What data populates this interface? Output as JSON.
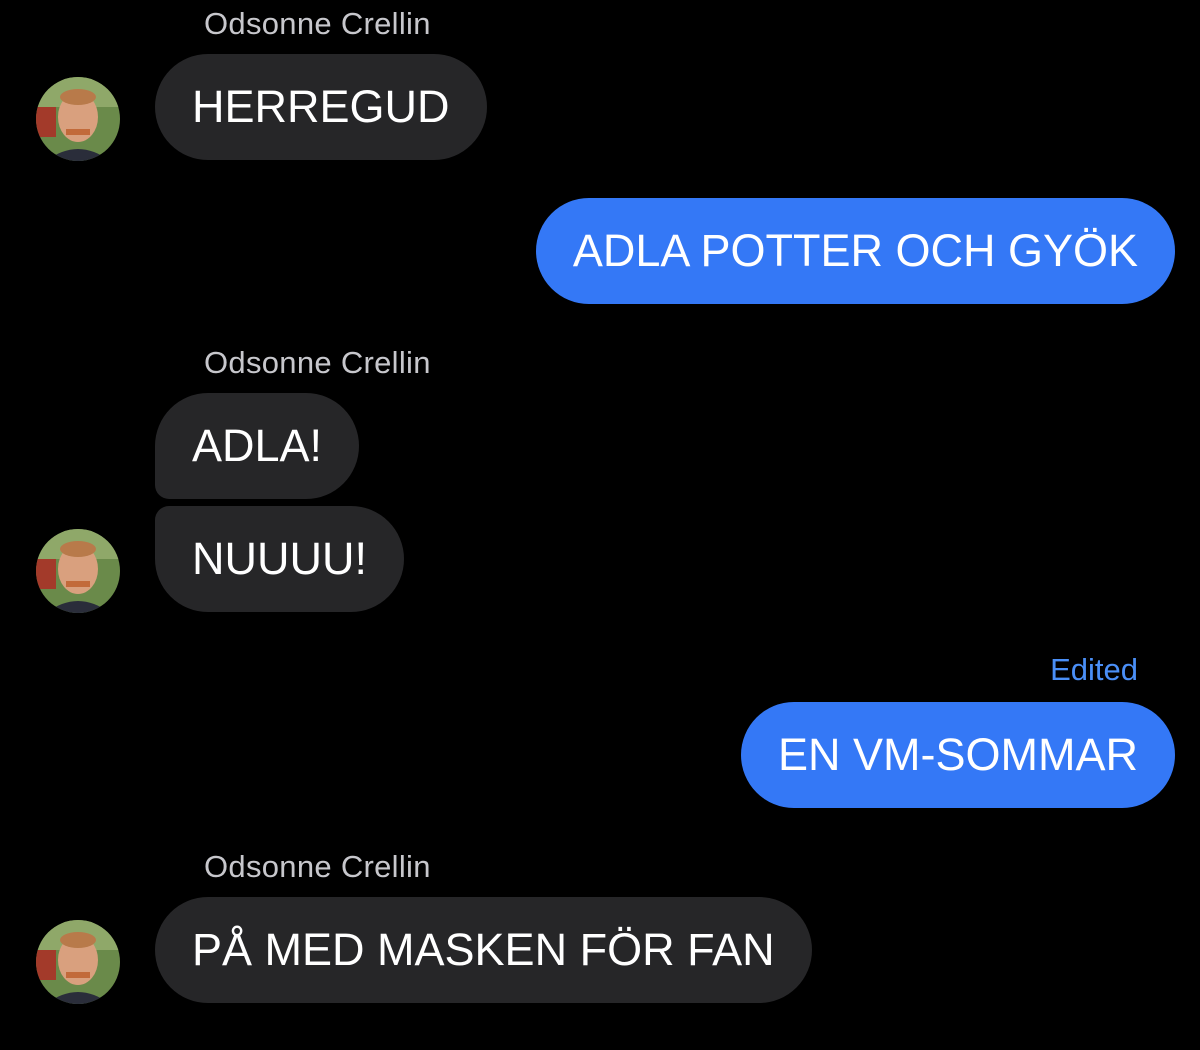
{
  "colors": {
    "background": "#000000",
    "incoming_bubble": "#262628",
    "outgoing_bubble": "#3478f6",
    "sender_name": "#c7c7cc",
    "edited_label": "#4a8ff7"
  },
  "conversation": {
    "group1": {
      "sender": "Odsonne Crellin",
      "messages": [
        "HERREGUD"
      ],
      "avatar_icon": "contact-photo-avatar"
    },
    "outgoing1": {
      "text": "ADLA POTTER OCH GYÖK"
    },
    "group2": {
      "sender": "Odsonne Crellin",
      "messages": [
        "ADLA!",
        "NUUUU!"
      ],
      "avatar_icon": "contact-photo-avatar"
    },
    "outgoing2": {
      "edited_label": "Edited",
      "text": "EN VM-SOMMAR"
    },
    "group3": {
      "sender": "Odsonne Crellin",
      "messages": [
        "PÅ MED MASKEN FÖR FAN"
      ],
      "avatar_icon": "contact-photo-avatar"
    }
  }
}
